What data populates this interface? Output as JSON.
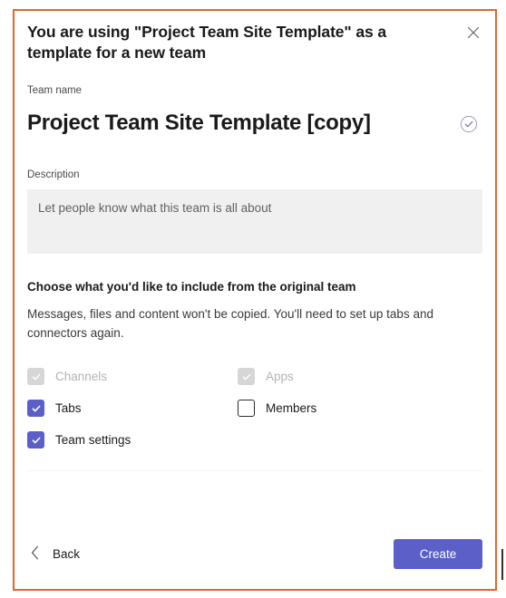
{
  "dialog": {
    "title": "You are using \"Project Team Site Template\" as a template for a new team",
    "close_label": "Close",
    "close_icon": "close-icon"
  },
  "team_name": {
    "label": "Team name",
    "value": "Project Team Site Template [copy]",
    "status_icon": "circle-check-icon"
  },
  "description": {
    "label": "Description",
    "placeholder": "Let people know what this team is all about",
    "value": ""
  },
  "include_section": {
    "heading": "Choose what you'd like to include from the original team",
    "subtext": "Messages, files and content won't be copied. You'll need to set up tabs and connectors again.",
    "options": [
      {
        "label": "Channels",
        "state": "disabled",
        "column": "left"
      },
      {
        "label": "Apps",
        "state": "disabled",
        "column": "right"
      },
      {
        "label": "Tabs",
        "state": "checked",
        "column": "left"
      },
      {
        "label": "Members",
        "state": "unchecked",
        "column": "right"
      },
      {
        "label": "Team settings",
        "state": "checked",
        "column": "left"
      }
    ]
  },
  "footer": {
    "back_label": "Back",
    "back_icon": "chevron-left-icon",
    "create_label": "Create"
  },
  "colors": {
    "accent": "#5b5fc7",
    "dialog_border": "#e2672a",
    "field_fill": "#f0f0f0",
    "disabled_checkbox": "#d6d6d6"
  }
}
